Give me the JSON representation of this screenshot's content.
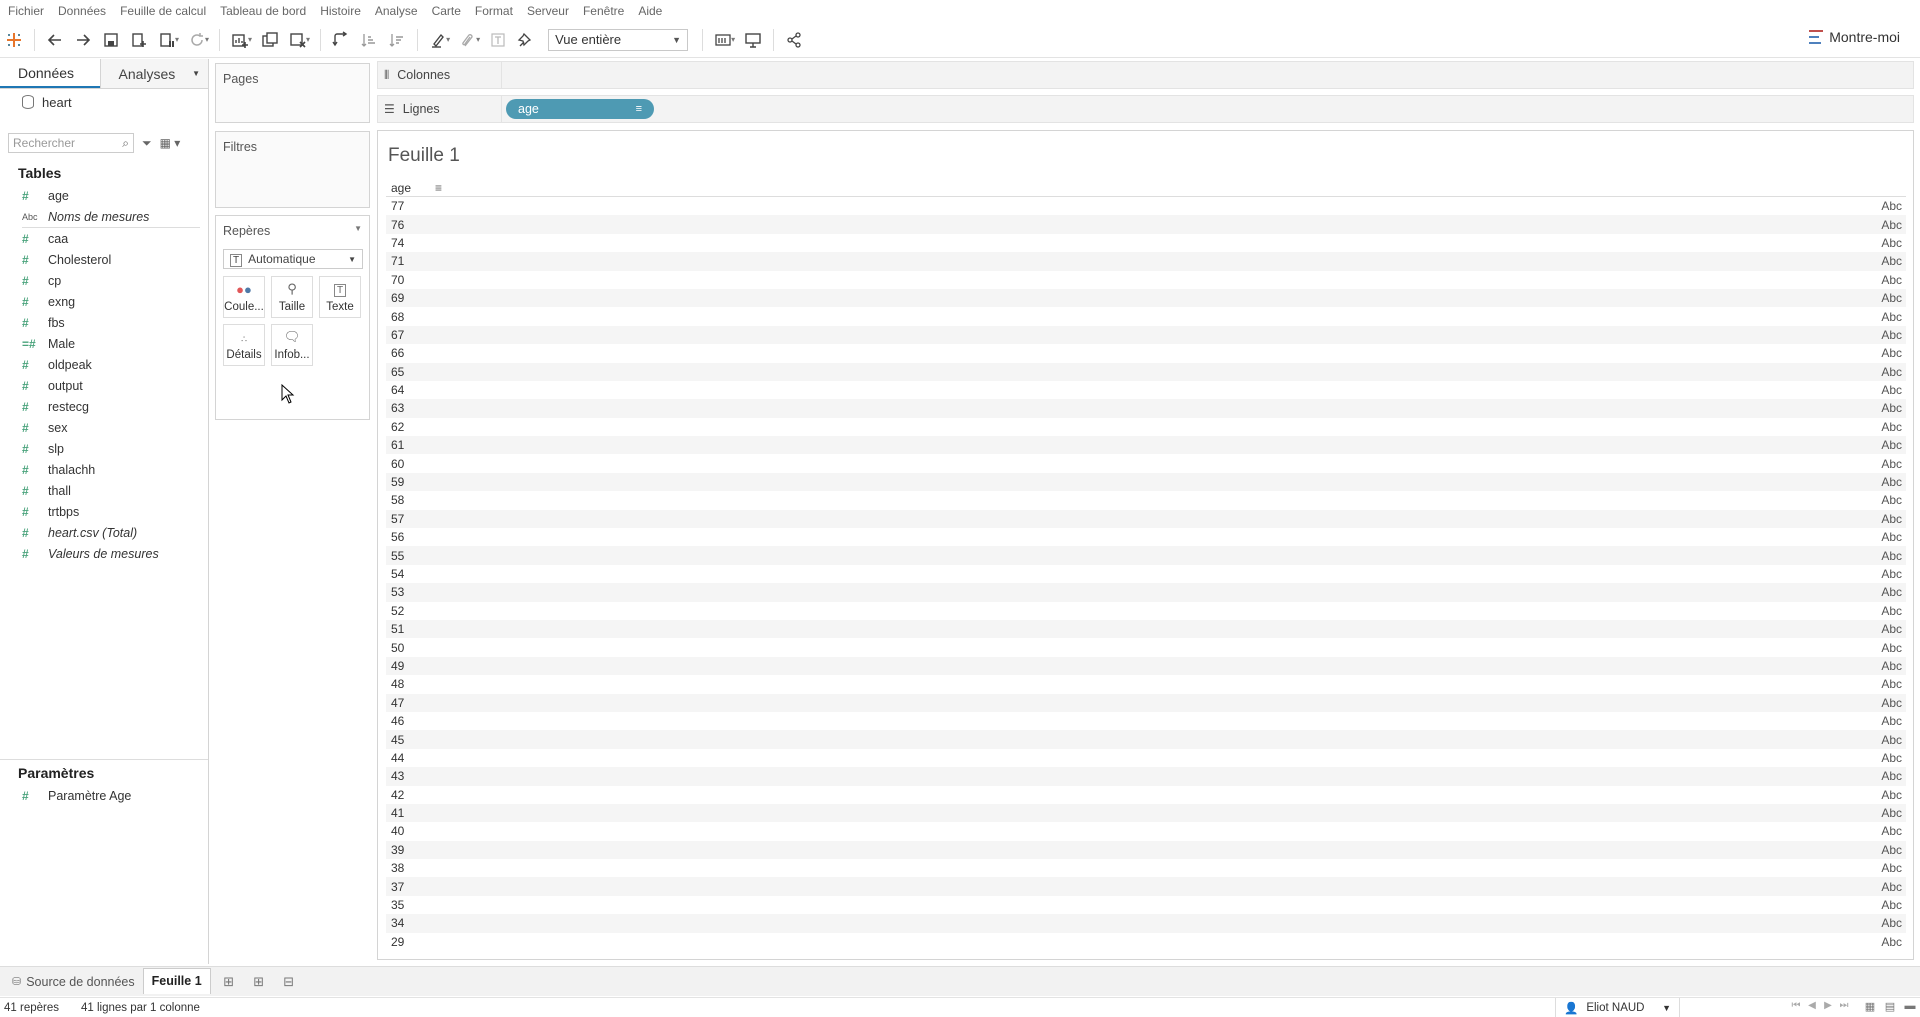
{
  "menu": [
    "Fichier",
    "Données",
    "Feuille de calcul",
    "Tableau de bord",
    "Histoire",
    "Analyse",
    "Carte",
    "Format",
    "Serveur",
    "Fenêtre",
    "Aide"
  ],
  "toolbar": {
    "view_select": "Vue entière",
    "show_me": "Montre-moi"
  },
  "data_pane": {
    "tab_data": "Données",
    "tab_analytics": "Analyses",
    "datasource": "heart",
    "search_placeholder": "Rechercher",
    "tables_header": "Tables",
    "fields": [
      {
        "name": "age",
        "icon": "#",
        "italic": false
      },
      {
        "name": "Noms de mesures",
        "icon": "Abc",
        "italic": true
      },
      {
        "name": "caa",
        "icon": "#",
        "italic": false
      },
      {
        "name": "Cholesterol",
        "icon": "#",
        "italic": false
      },
      {
        "name": "cp",
        "icon": "#",
        "italic": false
      },
      {
        "name": "exng",
        "icon": "#",
        "italic": false
      },
      {
        "name": "fbs",
        "icon": "#",
        "italic": false
      },
      {
        "name": "Male",
        "icon": "=#",
        "italic": false
      },
      {
        "name": "oldpeak",
        "icon": "#",
        "italic": false
      },
      {
        "name": "output",
        "icon": "#",
        "italic": false
      },
      {
        "name": "restecg",
        "icon": "#",
        "italic": false
      },
      {
        "name": "sex",
        "icon": "#",
        "italic": false
      },
      {
        "name": "slp",
        "icon": "#",
        "italic": false
      },
      {
        "name": "thalachh",
        "icon": "#",
        "italic": false
      },
      {
        "name": "thall",
        "icon": "#",
        "italic": false
      },
      {
        "name": "trtbps",
        "icon": "#",
        "italic": false
      },
      {
        "name": "heart.csv (Total)",
        "icon": "#",
        "italic": true
      },
      {
        "name": "Valeurs de mesures",
        "icon": "#",
        "italic": true
      }
    ],
    "params_header": "Paramètres",
    "param": "Paramètre Age"
  },
  "cards": {
    "pages": "Pages",
    "filters": "Filtres",
    "marks": "Repères",
    "marks_type": "Automatique",
    "buttons": [
      "Coule...",
      "Taille",
      "Texte",
      "Détails",
      "Infob..."
    ]
  },
  "shelves": {
    "columns": "Colonnes",
    "rows": "Lignes",
    "row_pill": "age"
  },
  "view": {
    "title": "Feuille 1",
    "column_header": "age",
    "cell_text": "Abc",
    "ages": [
      "77",
      "76",
      "74",
      "71",
      "70",
      "69",
      "68",
      "67",
      "66",
      "65",
      "64",
      "63",
      "62",
      "61",
      "60",
      "59",
      "58",
      "57",
      "56",
      "55",
      "54",
      "53",
      "52",
      "51",
      "50",
      "49",
      "48",
      "47",
      "46",
      "45",
      "44",
      "43",
      "42",
      "41",
      "40",
      "39",
      "38",
      "37",
      "35",
      "34",
      "29"
    ]
  },
  "tabs": {
    "datasource": "Source de données",
    "sheet": "Feuille 1"
  },
  "status": {
    "marks": "41 repères",
    "dims": "41 lignes par 1 colonne",
    "user": "Eliot NAUD"
  },
  "colors": {
    "pill": "#4e9ab3",
    "measure": "#4aa37c"
  }
}
